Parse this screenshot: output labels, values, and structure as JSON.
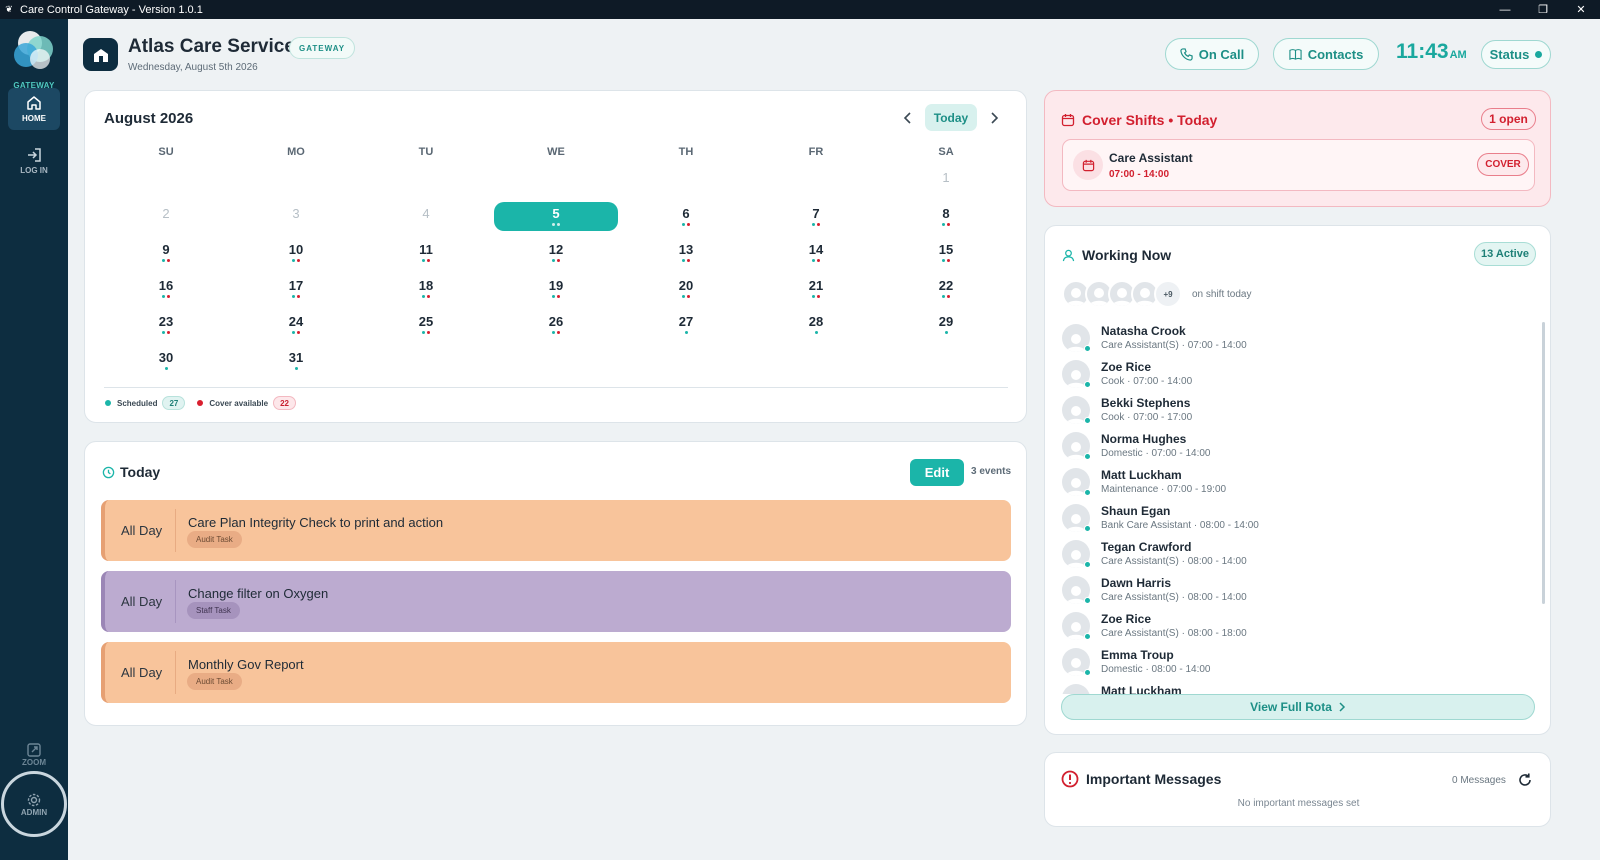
{
  "window": {
    "title": "Care Control Gateway - Version 1.0.1"
  },
  "sidebar": {
    "logo_text": "GATEWAY",
    "items": [
      {
        "label": "HOME",
        "icon": "home-icon",
        "active": true
      },
      {
        "label": "LOG IN",
        "icon": "login-icon",
        "active": false
      }
    ],
    "zoom_label": "ZOOM",
    "admin_label": "ADMIN"
  },
  "header": {
    "org_name": "Atlas Care Services",
    "badge": "GATEWAY",
    "date": "Wednesday, August 5th 2026",
    "on_call_label": "On Call",
    "contacts_label": "Contacts",
    "time": "11:43",
    "ampm": "AM",
    "status_label": "Status"
  },
  "calendar": {
    "title": "August 2026",
    "today_label": "Today",
    "weekdays": [
      "SU",
      "MO",
      "TU",
      "WE",
      "TH",
      "FR",
      "SA"
    ],
    "weeks": [
      [
        null,
        null,
        null,
        null,
        null,
        null,
        {
          "d": "1",
          "muted": true,
          "dots": []
        }
      ],
      [
        {
          "d": "2",
          "muted": true,
          "dots": []
        },
        {
          "d": "3",
          "muted": true,
          "dots": []
        },
        {
          "d": "4",
          "muted": true,
          "dots": []
        },
        {
          "d": "5",
          "selected": true,
          "dots": [
            "s",
            "s"
          ]
        },
        {
          "d": "6",
          "dots": [
            "s",
            "c"
          ]
        },
        {
          "d": "7",
          "dots": [
            "s",
            "c"
          ]
        },
        {
          "d": "8",
          "dots": [
            "s",
            "c"
          ]
        }
      ],
      [
        {
          "d": "9",
          "dots": [
            "s",
            "c"
          ]
        },
        {
          "d": "10",
          "dots": [
            "s",
            "c"
          ]
        },
        {
          "d": "11",
          "dots": [
            "s",
            "c"
          ]
        },
        {
          "d": "12",
          "dots": [
            "s",
            "c"
          ]
        },
        {
          "d": "13",
          "dots": [
            "s",
            "c"
          ]
        },
        {
          "d": "14",
          "dots": [
            "s",
            "c"
          ]
        },
        {
          "d": "15",
          "dots": [
            "s",
            "c"
          ]
        }
      ],
      [
        {
          "d": "16",
          "dots": [
            "s",
            "c"
          ]
        },
        {
          "d": "17",
          "dots": [
            "s",
            "c"
          ]
        },
        {
          "d": "18",
          "dots": [
            "s",
            "c"
          ]
        },
        {
          "d": "19",
          "dots": [
            "s",
            "c"
          ]
        },
        {
          "d": "20",
          "dots": [
            "s",
            "c"
          ]
        },
        {
          "d": "21",
          "dots": [
            "s",
            "c"
          ]
        },
        {
          "d": "22",
          "dots": [
            "s",
            "c"
          ]
        }
      ],
      [
        {
          "d": "23",
          "dots": [
            "s",
            "c"
          ]
        },
        {
          "d": "24",
          "dots": [
            "s",
            "c"
          ]
        },
        {
          "d": "25",
          "dots": [
            "s",
            "c"
          ]
        },
        {
          "d": "26",
          "dots": [
            "s",
            "c"
          ]
        },
        {
          "d": "27",
          "dots": [
            "s"
          ]
        },
        {
          "d": "28",
          "dots": [
            "s"
          ]
        },
        {
          "d": "29",
          "dots": [
            "s"
          ]
        }
      ],
      [
        {
          "d": "30",
          "dots": [
            "s"
          ]
        },
        {
          "d": "31",
          "dots": [
            "s"
          ]
        },
        null,
        null,
        null,
        null,
        null
      ]
    ],
    "legend": {
      "scheduled_label": "Scheduled",
      "scheduled_count": "27",
      "cover_label": "Cover available",
      "cover_count": "22"
    }
  },
  "today": {
    "title": "Today",
    "edit_label": "Edit",
    "events_count": "3 events",
    "events": [
      {
        "when": "All Day",
        "title": "Care Plan Integrity Check to print and action",
        "tag": "Audit Task",
        "style": "orange"
      },
      {
        "when": "All Day",
        "title": "Change filter on Oxygen",
        "tag": "Staff Task",
        "style": "purple"
      },
      {
        "when": "All Day",
        "title": "Monthly Gov Report",
        "tag": "Audit Task",
        "style": "orange"
      }
    ]
  },
  "cover_shifts": {
    "title": "Cover Shifts • Today",
    "open_label": "1 open",
    "item": {
      "role": "Care Assistant",
      "time": "07:00 - 14:00",
      "button": "COVER"
    }
  },
  "working_now": {
    "title": "Working Now",
    "active_label": "13 Active",
    "more_label": "+9",
    "on_shift_label": "on shift today",
    "staff": [
      {
        "name": "Natasha Crook",
        "detail": "Care Assistant(S) · 07:00 - 14:00"
      },
      {
        "name": "Zoe Rice",
        "detail": "Cook · 07:00 - 14:00"
      },
      {
        "name": "Bekki Stephens",
        "detail": "Cook · 07:00 - 17:00"
      },
      {
        "name": "Norma Hughes",
        "detail": "Domestic · 07:00 - 14:00"
      },
      {
        "name": "Matt Luckham",
        "detail": "Maintenance · 07:00 - 19:00"
      },
      {
        "name": "Shaun Egan",
        "detail": "Bank Care Assistant · 08:00 - 14:00"
      },
      {
        "name": "Tegan Crawford",
        "detail": "Care Assistant(S) · 08:00 - 14:00"
      },
      {
        "name": "Dawn Harris",
        "detail": "Care Assistant(S) · 08:00 - 14:00"
      },
      {
        "name": "Zoe Rice",
        "detail": "Care Assistant(S) · 08:00 - 18:00"
      },
      {
        "name": "Emma Troup",
        "detail": "Domestic · 08:00 - 14:00"
      },
      {
        "name": "Matt Luckham",
        "detail": ""
      }
    ],
    "view_rota_label": "View Full Rota"
  },
  "messages": {
    "title": "Important Messages",
    "count": "0 Messages",
    "empty": "No important messages set"
  },
  "colors": {
    "teal": "#1bb5a9",
    "navy": "#0d2d40",
    "cover_red": "#d2202f",
    "event_orange": "#f8c49b",
    "event_purple": "#bcabd0"
  }
}
